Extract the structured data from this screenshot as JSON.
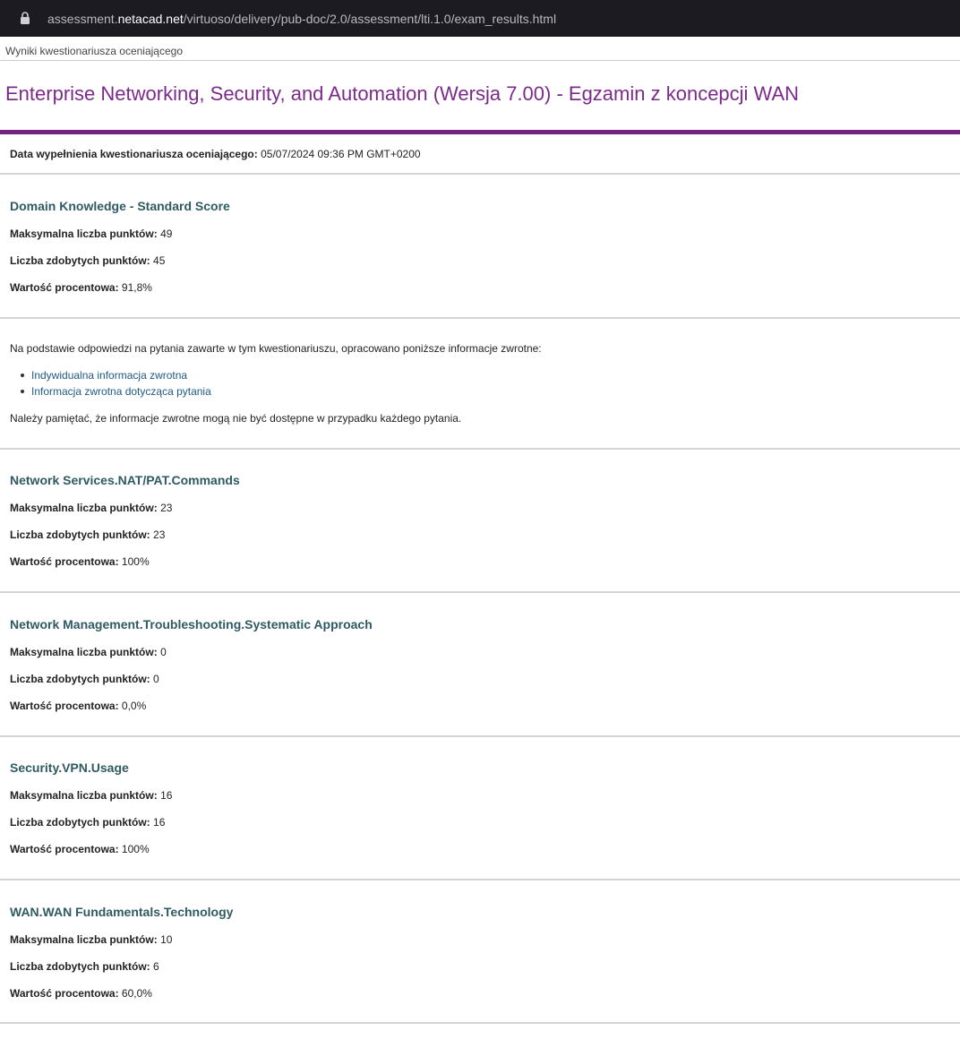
{
  "browser": {
    "url_prefix": "assessment.",
    "url_domain": "netacad.net",
    "url_path": "/virtuoso/delivery/pub-doc/2.0/assessment/lti.1.0/exam_results.html",
    "lock_icon": "lock-icon"
  },
  "breadcrumb": "Wyniki kwestionariusza oceniającego",
  "title": "Enterprise Networking, Security, and Automation (Wersja 7.00) - Egzamin z koncepcji WAN",
  "date": {
    "label": "Data wypełnienia kwestionariusza oceniającego:",
    "value": "05/07/2024 09:36 PM GMT+0200"
  },
  "labels": {
    "max": "Maksymalna liczba punktów:",
    "earned": "Liczba zdobytych punktów:",
    "percent": "Wartość procentowa:"
  },
  "sections": [
    {
      "title": "Domain Knowledge - Standard Score",
      "max": "49",
      "earned": "45",
      "percent": "91,8%"
    },
    {
      "title": "Network Services.NAT/PAT.Commands",
      "max": "23",
      "earned": "23",
      "percent": "100%"
    },
    {
      "title": "Network Management.Troubleshooting.Systematic Approach",
      "max": "0",
      "earned": "0",
      "percent": "0,0%"
    },
    {
      "title": "Security.VPN.Usage",
      "max": "16",
      "earned": "16",
      "percent": "100%"
    },
    {
      "title": "WAN.WAN Fundamentals.Technology",
      "max": "10",
      "earned": "6",
      "percent": "60,0%"
    }
  ],
  "feedback": {
    "intro": "Na podstawie odpowiedzi na pytania zawarte w tym kwestionariuszu, opracowano poniższe informacje zwrotne:",
    "links": [
      "Indywidualna informacja zwrotna",
      "Informacja zwrotna dotycząca pytania"
    ],
    "note": "Należy pamiętać, że informacje zwrotne mogą nie być dostępne w przypadku każdego pytania."
  },
  "colors": {
    "title": "#7b2a8a",
    "rule": "#71227f",
    "section_heading": "#2f5a63",
    "link": "#1f5a86",
    "urlbar": "#1c1b22"
  }
}
